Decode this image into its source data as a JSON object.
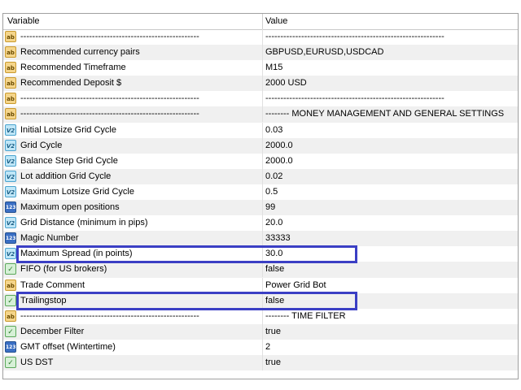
{
  "header": {
    "variable": "Variable",
    "value": "Value"
  },
  "rows": [
    {
      "icon": "ab",
      "name": "------------------------------------------------------------",
      "value": "------------------------------------------------------------"
    },
    {
      "icon": "ab",
      "name": "Recommended currency pairs",
      "value": "GBPUSD,EURUSD,USDCAD"
    },
    {
      "icon": "ab",
      "name": "Recommended Timeframe",
      "value": "M15"
    },
    {
      "icon": "ab",
      "name": "Recommended Deposit $",
      "value": "2000 USD"
    },
    {
      "icon": "ab",
      "name": "------------------------------------------------------------",
      "value": "------------------------------------------------------------"
    },
    {
      "icon": "ab",
      "name": "------------------------------------------------------------",
      "value": "-------- MONEY MANAGEMENT AND GENERAL SETTINGS"
    },
    {
      "icon": "v2",
      "name": "Initial Lotsize Grid Cycle",
      "value": "0.03"
    },
    {
      "icon": "v2",
      "name": "Grid Cycle",
      "value": "2000.0"
    },
    {
      "icon": "v2",
      "name": "Balance Step Grid Cycle",
      "value": "2000.0"
    },
    {
      "icon": "v2",
      "name": "Lot addition Grid Cycle",
      "value": "0.02"
    },
    {
      "icon": "v2",
      "name": "Maximum Lotsize Grid Cycle",
      "value": "0.5"
    },
    {
      "icon": "n123",
      "name": "Maximum open positions",
      "value": "99"
    },
    {
      "icon": "v2",
      "name": "Grid Distance (minimum in pips)",
      "value": "20.0"
    },
    {
      "icon": "n123",
      "name": "Magic Number",
      "value": "33333"
    },
    {
      "icon": "v2",
      "name": "Maximum Spread (in points)",
      "value": "30.0"
    },
    {
      "icon": "bool",
      "name": "FIFO (for US brokers)",
      "value": "false"
    },
    {
      "icon": "ab",
      "name": "Trade Comment",
      "value": "Power Grid Bot"
    },
    {
      "icon": "bool",
      "name": "Trailingstop",
      "value": "false"
    },
    {
      "icon": "ab",
      "name": "------------------------------------------------------------",
      "value": "-------- TIME FILTER"
    },
    {
      "icon": "bool",
      "name": "December Filter",
      "value": "true"
    },
    {
      "icon": "n123",
      "name": "GMT offset (Wintertime)",
      "value": "2"
    },
    {
      "icon": "bool",
      "name": "US DST",
      "value": "true"
    }
  ],
  "icon_glyphs": {
    "ab": "ab",
    "v2": "V2",
    "n123": "123",
    "bool": "✓"
  },
  "highlight_color": "#3b3fc4"
}
